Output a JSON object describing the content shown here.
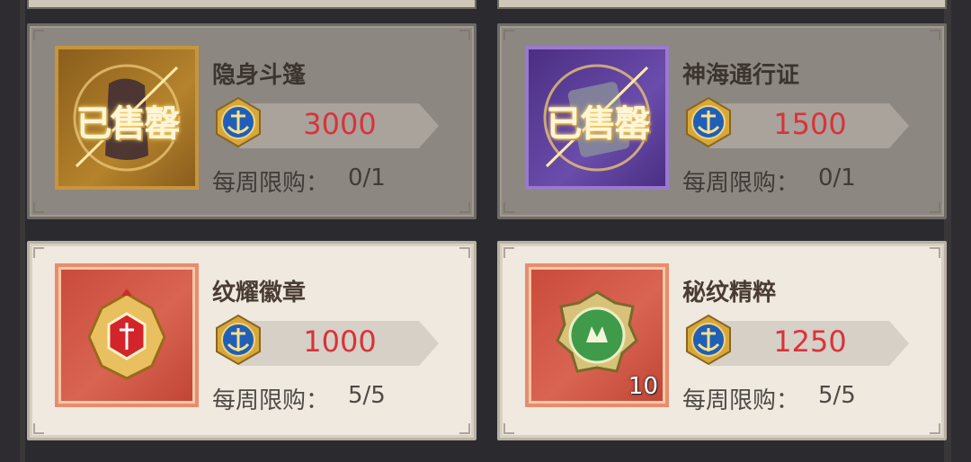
{
  "items": [
    {
      "name": "隐身斗篷",
      "price": "3000",
      "limit_label": "每周限购：",
      "limit_value": "0/1",
      "sold_out": true,
      "sold_label": "已售罄",
      "frame": "gold",
      "quantity": ""
    },
    {
      "name": "神海通行证",
      "price": "1500",
      "limit_label": "每周限购：",
      "limit_value": "0/1",
      "sold_out": true,
      "sold_label": "已售罄",
      "frame": "purple",
      "quantity": ""
    },
    {
      "name": "纹耀徽章",
      "price": "1000",
      "limit_label": "每周限购：",
      "limit_value": "5/5",
      "sold_out": false,
      "sold_label": "",
      "frame": "red",
      "quantity": ""
    },
    {
      "name": "秘纹精粹",
      "price": "1250",
      "limit_label": "每周限购：",
      "limit_value": "5/5",
      "sold_out": false,
      "sold_label": "",
      "frame": "red",
      "quantity": "10"
    }
  ],
  "currency_icon": "anchor-coin-icon",
  "colors": {
    "price_red": "#d8333b",
    "sold_bg": "#8c8780",
    "avail_bg": "#efe9df"
  }
}
